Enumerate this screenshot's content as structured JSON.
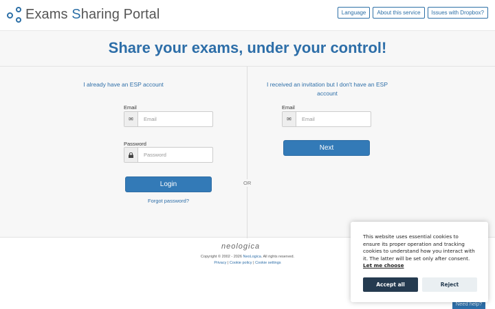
{
  "header": {
    "logo_prefix": "Exams ",
    "logo_highlight": "S",
    "logo_suffix": "haring Portal",
    "buttons": {
      "language": "Language",
      "about": "About this service",
      "dropbox": "Issues with Dropbox?"
    }
  },
  "hero": {
    "title": "Share your exams, under your control!"
  },
  "login": {
    "title": "I already have an ESP account",
    "email_label": "Email",
    "email_placeholder": "Email",
    "password_label": "Password",
    "password_placeholder": "Password",
    "login_button": "Login",
    "forgot_link": "Forgot password?"
  },
  "divider": "OR",
  "invitation": {
    "title": "I received an invitation but I don't have an ESP account",
    "email_label": "Email",
    "email_placeholder": "Email",
    "next_button": "Next"
  },
  "footer": {
    "brand": "neologica",
    "copyright_prefix": "Copyright © 2002 - 2026 ",
    "copyright_company": "NeoLogica",
    "copyright_suffix": ". All rights reserved.",
    "links": {
      "privacy": "Privacy",
      "cookie_policy": "Cookie policy",
      "cookie_settings": "Cookie settings"
    },
    "separator": "|"
  },
  "cookie_banner": {
    "text": "This website uses essential cookies to ensure its proper operation and tracking cookies to understand how you interact with it. The latter will be set only after consent.",
    "choose_link": "Let me choose",
    "accept": "Accept all",
    "reject": "Reject"
  },
  "help": {
    "label": "Need help?"
  },
  "colors": {
    "primary": "#337ab7",
    "brand_blue": "#2d6ea8",
    "cookie_dark": "#253b50"
  }
}
